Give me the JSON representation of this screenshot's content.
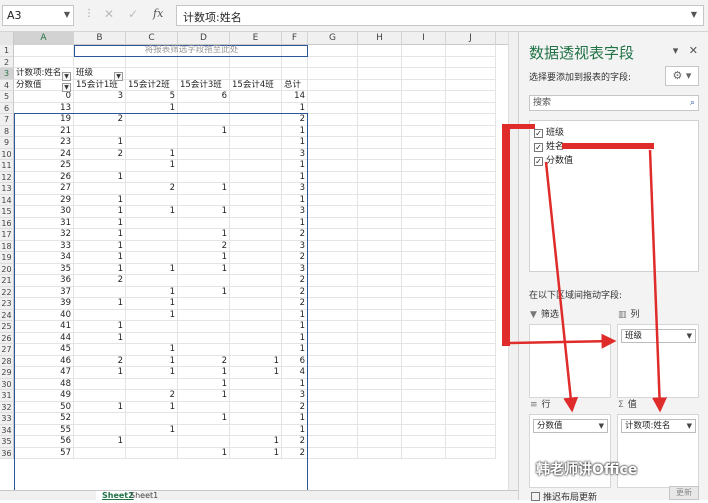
{
  "formula_bar": {
    "name_box": "A3",
    "cancel_icon": "✕",
    "enter_icon": "✓",
    "fx_label": "fx",
    "formula": "计数项:姓名"
  },
  "columns": [
    "A",
    "B",
    "C",
    "D",
    "E",
    "F",
    "G",
    "H",
    "I",
    "J"
  ],
  "selected_column": "A",
  "pivot": {
    "filter_hint": "将报表筛选字段拖至此处",
    "corner_label": "计数项:姓名",
    "col_field_label": "班级",
    "row_field_label": "分数值",
    "col_headers": [
      "15会计1班",
      "15会计2班",
      "15会计3班",
      "15会计4班",
      "总计"
    ],
    "rows": [
      {
        "r": "5",
        "v": "0",
        "b": "3",
        "c": "5",
        "d": "6",
        "e": "",
        "f": "14"
      },
      {
        "r": "6",
        "v": "13",
        "b": "",
        "c": "1",
        "d": "",
        "e": "",
        "f": "1"
      },
      {
        "r": "7",
        "v": "19",
        "b": "2",
        "c": "",
        "d": "",
        "e": "",
        "f": "2"
      },
      {
        "r": "8",
        "v": "21",
        "b": "",
        "c": "",
        "d": "1",
        "e": "",
        "f": "1"
      },
      {
        "r": "9",
        "v": "23",
        "b": "1",
        "c": "",
        "d": "",
        "e": "",
        "f": "1"
      },
      {
        "r": "10",
        "v": "24",
        "b": "2",
        "c": "1",
        "d": "",
        "e": "",
        "f": "3"
      },
      {
        "r": "11",
        "v": "25",
        "b": "",
        "c": "1",
        "d": "",
        "e": "",
        "f": "1"
      },
      {
        "r": "12",
        "v": "26",
        "b": "1",
        "c": "",
        "d": "",
        "e": "",
        "f": "1"
      },
      {
        "r": "13",
        "v": "27",
        "b": "",
        "c": "2",
        "d": "1",
        "e": "",
        "f": "3"
      },
      {
        "r": "14",
        "v": "29",
        "b": "1",
        "c": "",
        "d": "",
        "e": "",
        "f": "1"
      },
      {
        "r": "15",
        "v": "30",
        "b": "1",
        "c": "1",
        "d": "1",
        "e": "",
        "f": "3"
      },
      {
        "r": "16",
        "v": "31",
        "b": "1",
        "c": "",
        "d": "",
        "e": "",
        "f": "1"
      },
      {
        "r": "17",
        "v": "32",
        "b": "1",
        "c": "",
        "d": "1",
        "e": "",
        "f": "2"
      },
      {
        "r": "18",
        "v": "33",
        "b": "1",
        "c": "",
        "d": "2",
        "e": "",
        "f": "3"
      },
      {
        "r": "19",
        "v": "34",
        "b": "1",
        "c": "",
        "d": "1",
        "e": "",
        "f": "2"
      },
      {
        "r": "20",
        "v": "35",
        "b": "1",
        "c": "1",
        "d": "1",
        "e": "",
        "f": "3"
      },
      {
        "r": "21",
        "v": "36",
        "b": "2",
        "c": "",
        "d": "",
        "e": "",
        "f": "2"
      },
      {
        "r": "22",
        "v": "37",
        "b": "",
        "c": "1",
        "d": "1",
        "e": "",
        "f": "2"
      },
      {
        "r": "23",
        "v": "39",
        "b": "1",
        "c": "1",
        "d": "",
        "e": "",
        "f": "2"
      },
      {
        "r": "24",
        "v": "40",
        "b": "",
        "c": "1",
        "d": "",
        "e": "",
        "f": "1"
      },
      {
        "r": "25",
        "v": "41",
        "b": "1",
        "c": "",
        "d": "",
        "e": "",
        "f": "1"
      },
      {
        "r": "26",
        "v": "44",
        "b": "1",
        "c": "",
        "d": "",
        "e": "",
        "f": "1"
      },
      {
        "r": "27",
        "v": "45",
        "b": "",
        "c": "1",
        "d": "",
        "e": "",
        "f": "1"
      },
      {
        "r": "28",
        "v": "46",
        "b": "2",
        "c": "1",
        "d": "2",
        "e": "1",
        "f": "6"
      },
      {
        "r": "29",
        "v": "47",
        "b": "1",
        "c": "1",
        "d": "1",
        "e": "1",
        "f": "4"
      },
      {
        "r": "30",
        "v": "48",
        "b": "",
        "c": "",
        "d": "1",
        "e": "",
        "f": "1"
      },
      {
        "r": "31",
        "v": "49",
        "b": "",
        "c": "2",
        "d": "1",
        "e": "",
        "f": "3"
      },
      {
        "r": "32",
        "v": "50",
        "b": "1",
        "c": "1",
        "d": "",
        "e": "",
        "f": "2"
      },
      {
        "r": "33",
        "v": "52",
        "b": "",
        "c": "",
        "d": "1",
        "e": "",
        "f": "1"
      },
      {
        "r": "34",
        "v": "55",
        "b": "",
        "c": "1",
        "d": "",
        "e": "",
        "f": "1"
      },
      {
        "r": "35",
        "v": "56",
        "b": "1",
        "c": "",
        "d": "",
        "e": "1",
        "f": "2"
      },
      {
        "r": "36",
        "v": "57",
        "b": "",
        "c": "",
        "d": "1",
        "e": "1",
        "f": "2"
      }
    ]
  },
  "sheet_tabs": [
    "Sheet2",
    "Sheet1"
  ],
  "active_tab": "Sheet2",
  "pane": {
    "title": "数据透视表字段",
    "choose_label": "选择要添加到报表的字段:",
    "search_placeholder": "搜索",
    "fields": [
      {
        "label": "班级",
        "checked": true
      },
      {
        "label": "姓名",
        "checked": true
      },
      {
        "label": "分数值",
        "checked": true
      }
    ],
    "drag_label": "在以下区域间拖动字段:",
    "areas": {
      "filters": {
        "label": "筛选",
        "value": ""
      },
      "columns": {
        "label": "列",
        "value": "班级"
      },
      "rows": {
        "label": "行",
        "value": "分数值"
      },
      "values": {
        "label": "值",
        "value": "计数项:姓名"
      }
    },
    "defer_label": "推迟布局更新",
    "update_label": "更新"
  },
  "watermark": "韩老师讲Office",
  "accent_color": "#217346",
  "arrow_color": "#e02b2b"
}
